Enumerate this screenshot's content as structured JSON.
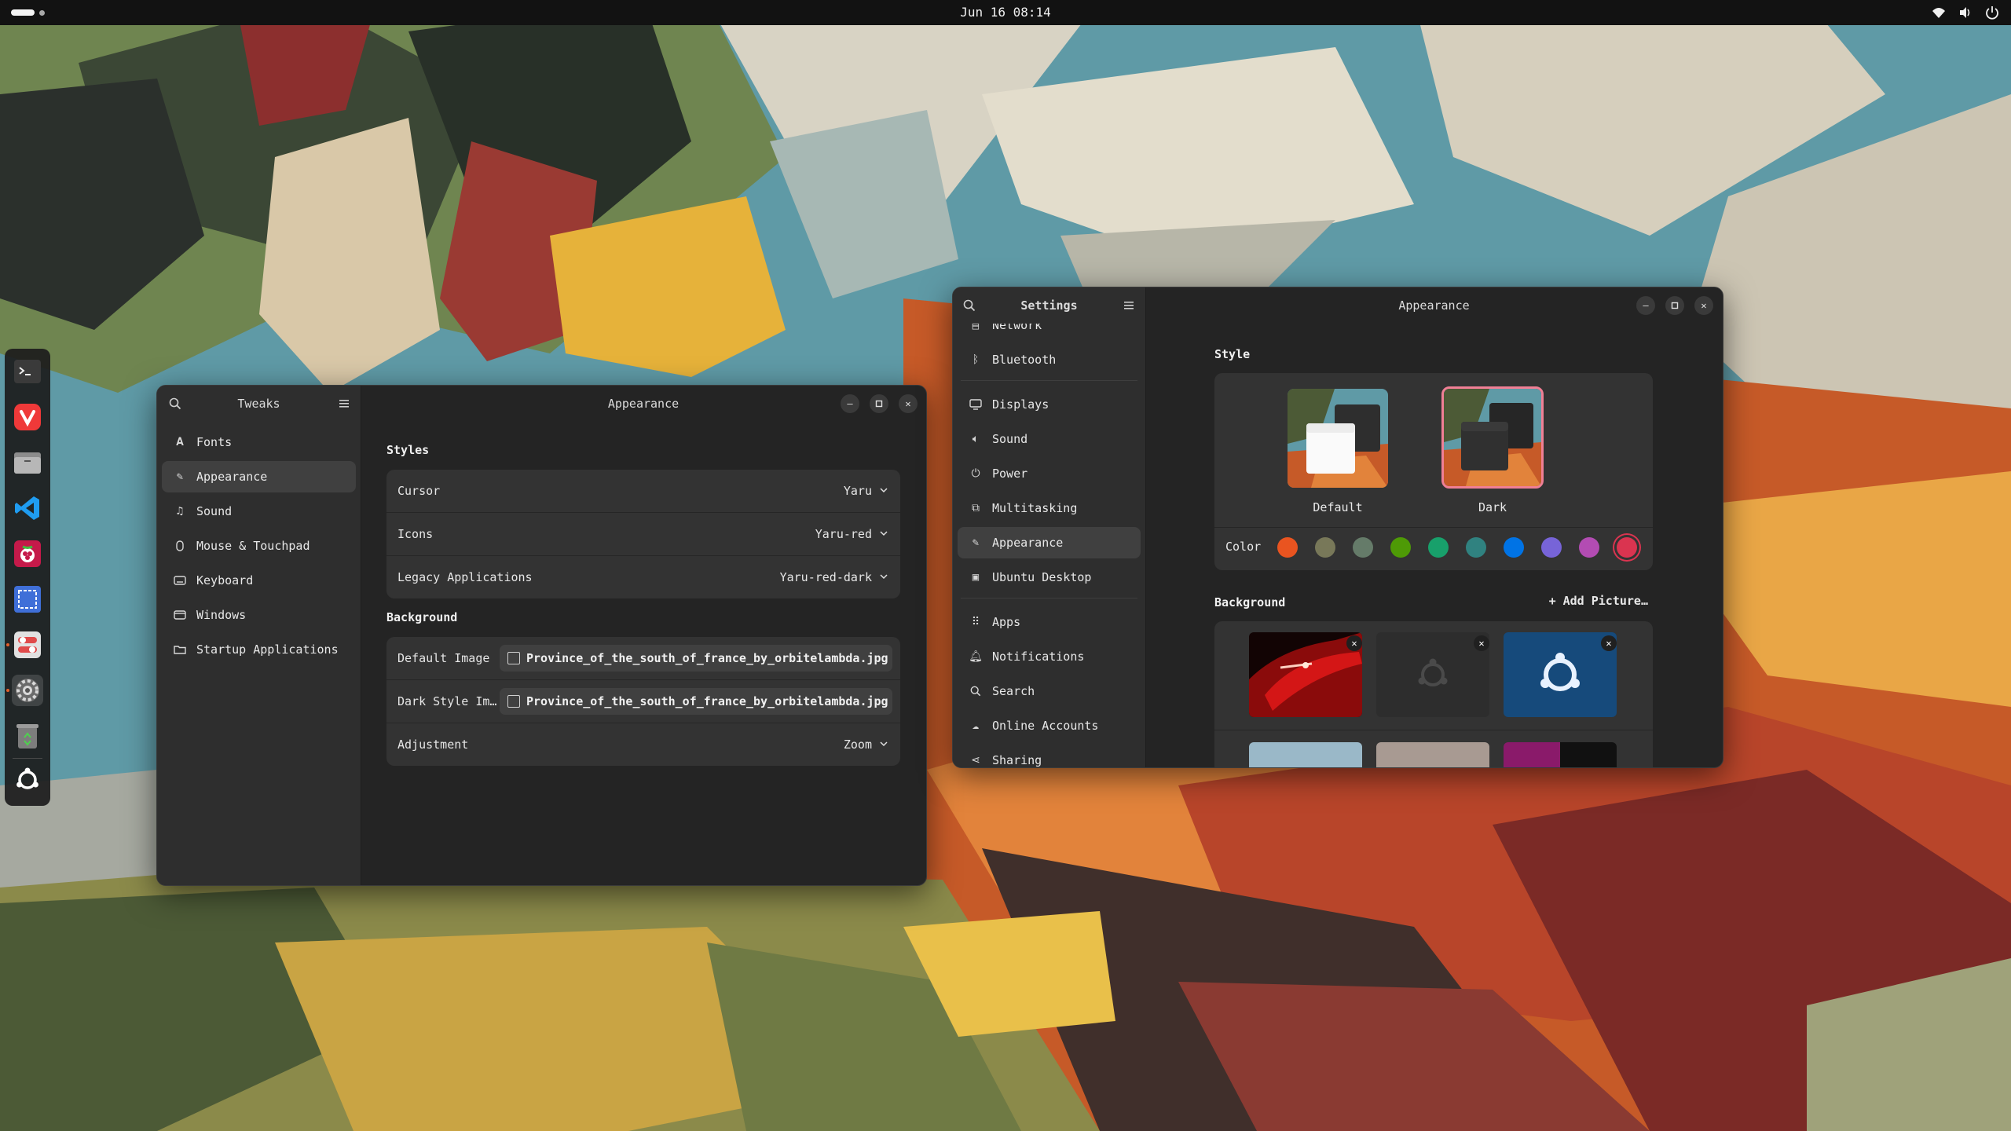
{
  "topbar": {
    "clock": "Jun 16  08:14",
    "tray_icons": [
      "wifi-icon",
      "volume-icon",
      "power-icon"
    ]
  },
  "dock": {
    "items": [
      {
        "name": "terminal",
        "icon": "terminal-icon"
      },
      {
        "name": "vivaldi",
        "icon": "vivaldi-icon"
      },
      {
        "name": "files",
        "icon": "files-icon"
      },
      {
        "name": "vscode",
        "icon": "vscode-icon"
      },
      {
        "name": "raspberry-pi-imager",
        "icon": "raspberry-icon"
      },
      {
        "name": "screenshot",
        "icon": "screenshot-icon"
      },
      {
        "name": "tweaks",
        "icon": "tweaks-icon"
      },
      {
        "name": "settings",
        "icon": "settings-icon"
      },
      {
        "name": "trash",
        "icon": "trash-icon"
      },
      {
        "name": "show-apps",
        "icon": "ubuntu-icon"
      }
    ]
  },
  "tweaks": {
    "sidebar_title": "Tweaks",
    "main_title": "Appearance",
    "nav": [
      {
        "label": "Fonts",
        "icon": "fonts-icon"
      },
      {
        "label": "Appearance",
        "icon": "appearance-icon",
        "selected": true
      },
      {
        "label": "Sound",
        "icon": "music-note-icon"
      },
      {
        "label": "Mouse & Touchpad",
        "icon": "mouse-icon"
      },
      {
        "label": "Keyboard",
        "icon": "keyboard-icon"
      },
      {
        "label": "Windows",
        "icon": "windows-icon"
      },
      {
        "label": "Startup Applications",
        "icon": "folder-icon"
      }
    ],
    "styles_heading": "Styles",
    "styles": [
      {
        "label": "Cursor",
        "value": "Yaru"
      },
      {
        "label": "Icons",
        "value": "Yaru-red"
      },
      {
        "label": "Legacy Applications",
        "value": "Yaru-red-dark"
      }
    ],
    "background_heading": "Background",
    "background": {
      "default_image_label": "Default Image",
      "default_image_value": "Province_of_the_south_of_france_by_orbitelambda.jpg",
      "dark_image_label": "Dark Style Im…",
      "dark_image_value": "Province_of_the_south_of_france_by_orbitelambda.jpg",
      "adjustment_label": "Adjustment",
      "adjustment_value": "Zoom"
    }
  },
  "settings": {
    "sidebar_title": "Settings",
    "main_title": "Appearance",
    "nav": [
      {
        "label": "Network",
        "icon": "network-icon"
      },
      {
        "label": "Bluetooth",
        "icon": "bluetooth-icon"
      },
      {
        "label": "Displays",
        "icon": "display-icon"
      },
      {
        "label": "Sound",
        "icon": "sound-icon"
      },
      {
        "label": "Power",
        "icon": "power-icon"
      },
      {
        "label": "Multitasking",
        "icon": "multitasking-icon"
      },
      {
        "label": "Appearance",
        "icon": "appearance-icon",
        "selected": true
      },
      {
        "label": "Ubuntu Desktop",
        "icon": "ubuntu-desktop-icon"
      },
      {
        "label": "Apps",
        "icon": "apps-icon"
      },
      {
        "label": "Notifications",
        "icon": "bell-icon"
      },
      {
        "label": "Search",
        "icon": "search-icon"
      },
      {
        "label": "Online Accounts",
        "icon": "cloud-icon"
      },
      {
        "label": "Sharing",
        "icon": "share-icon"
      }
    ],
    "style_heading": "Style",
    "style_options": [
      {
        "label": "Default",
        "selected": false
      },
      {
        "label": "Dark",
        "selected": true
      }
    ],
    "color_label": "Color",
    "colors": [
      "#e95420",
      "#787859",
      "#657b69",
      "#4e9a06",
      "#18a06b",
      "#308280",
      "#0073e5",
      "#7764d8",
      "#b34cb3",
      "#da3450"
    ],
    "selected_color": "#da3450",
    "background_heading": "Background",
    "add_picture_label": "+ Add Picture…"
  }
}
